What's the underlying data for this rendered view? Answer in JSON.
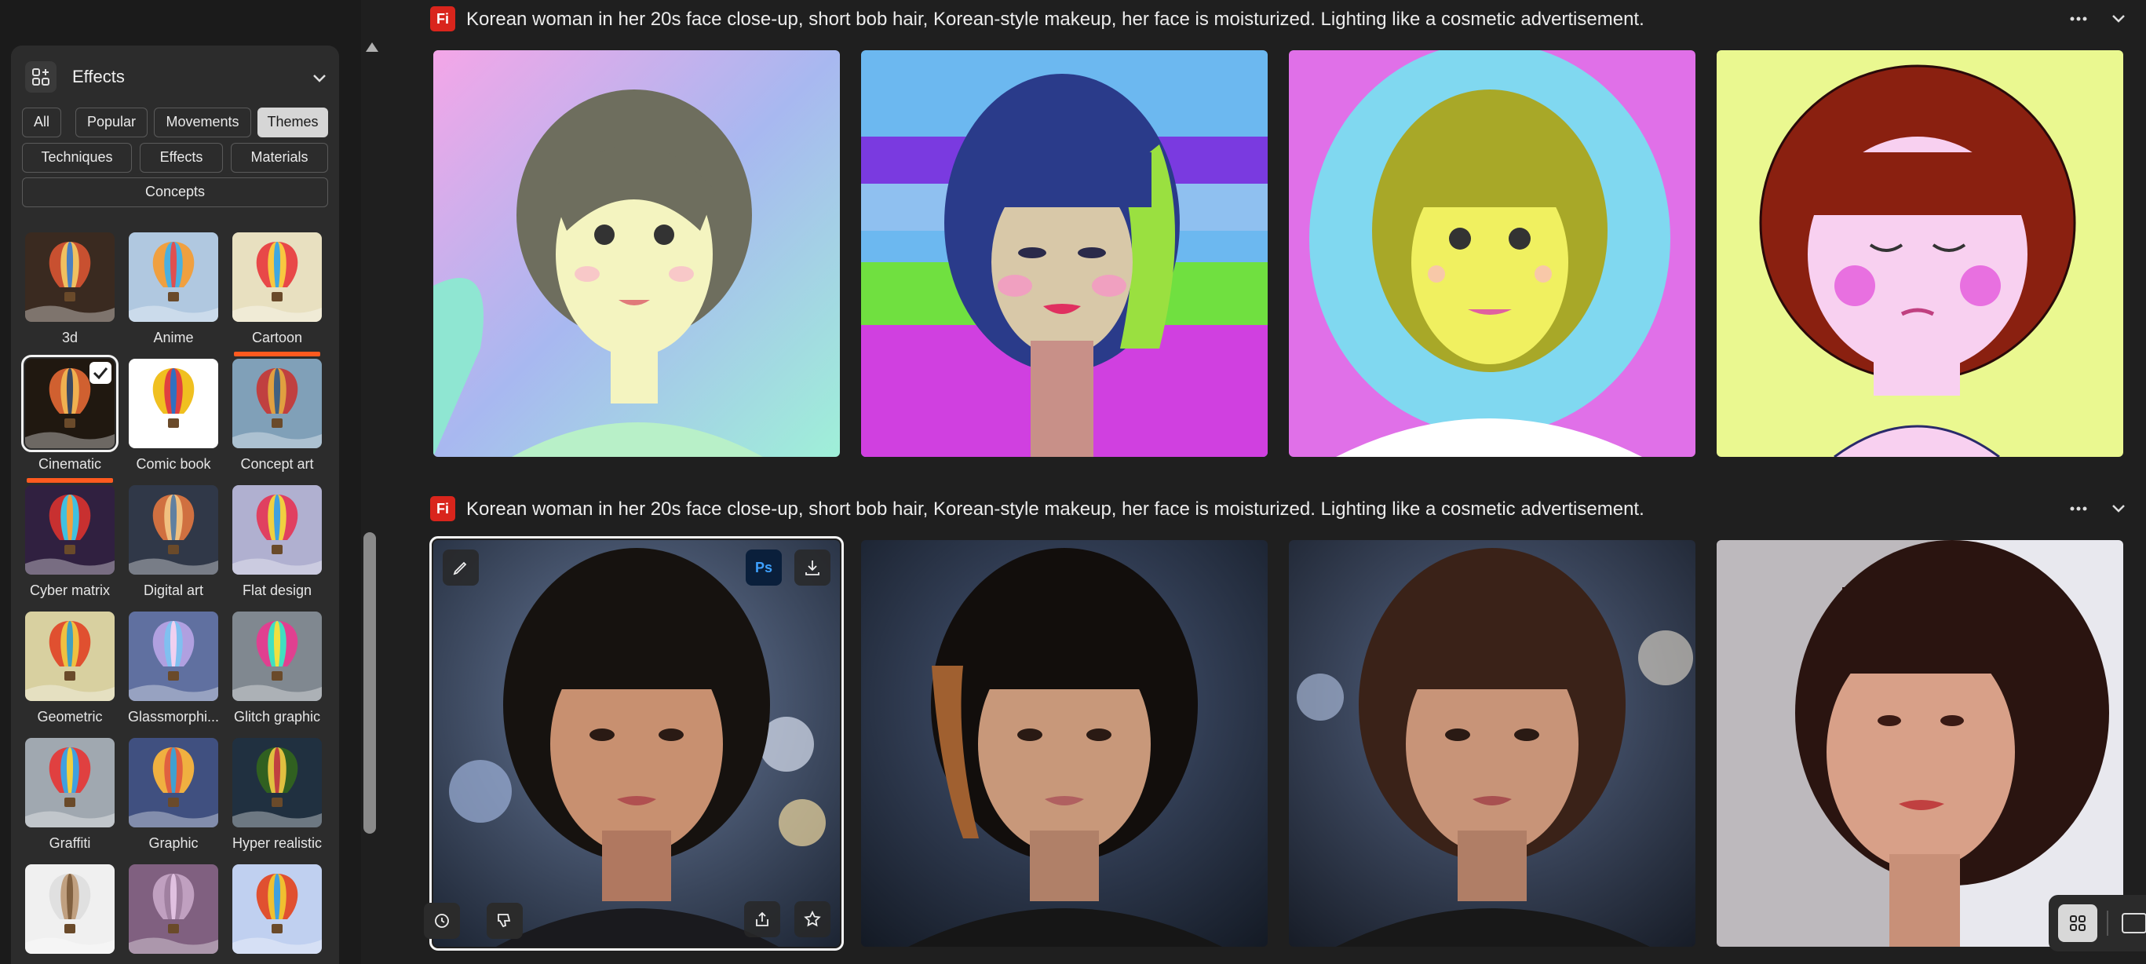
{
  "panel": {
    "title": "Effects",
    "filter_chips": [
      "All",
      "Popular",
      "Movements",
      "Themes",
      "Techniques",
      "Effects",
      "Materials",
      "Concepts"
    ],
    "active_chip": "Themes",
    "styles": [
      {
        "label": "3d",
        "selected": false
      },
      {
        "label": "Anime",
        "selected": false
      },
      {
        "label": "Cartoon",
        "selected": false,
        "underlined": true
      },
      {
        "label": "Cinematic",
        "selected": true,
        "underlined": true
      },
      {
        "label": "Comic book",
        "selected": false
      },
      {
        "label": "Concept art",
        "selected": false
      },
      {
        "label": "Cyber matrix",
        "selected": false
      },
      {
        "label": "Digital art",
        "selected": false
      },
      {
        "label": "Flat design",
        "selected": false
      },
      {
        "label": "Geometric",
        "selected": false
      },
      {
        "label": "Glassmorphi...",
        "selected": false
      },
      {
        "label": "Glitch graphic",
        "selected": false
      },
      {
        "label": "Graffiti",
        "selected": false
      },
      {
        "label": "Graphic",
        "selected": false
      },
      {
        "label": "Hyper realistic",
        "selected": false
      },
      {
        "label": "",
        "selected": false
      },
      {
        "label": "",
        "selected": false
      },
      {
        "label": "",
        "selected": false
      }
    ],
    "underline_color": "#ff5a1f"
  },
  "gallery": {
    "badge": "Fi",
    "badge_color": "#d9251c",
    "groups": [
      {
        "prompt": "Korean woman in her 20s face close-up, short bob hair, Korean-style makeup, her face is moisturized. Lighting like a cosmetic advertisement.",
        "images": [
          "cartoon-woman-1",
          "cartoon-woman-2",
          "cartoon-woman-3",
          "cartoon-woman-4"
        ]
      },
      {
        "prompt": "Korean woman in her 20s face close-up, short bob hair, Korean-style makeup, her face is moisturized. Lighting like a cosmetic advertisement.",
        "images": [
          "cinematic-woman-1",
          "cinematic-woman-2",
          "cinematic-woman-3",
          "cinematic-woman-4"
        ]
      }
    ],
    "image_actions": {
      "photoshop_label": "Ps"
    }
  },
  "icons": [
    "effects-icon",
    "chevron-down-icon",
    "more-icon",
    "pencil-icon",
    "download-icon",
    "history-icon",
    "thumbs-down-icon",
    "share-icon",
    "star-icon",
    "grid-view-icon",
    "single-view-icon"
  ]
}
